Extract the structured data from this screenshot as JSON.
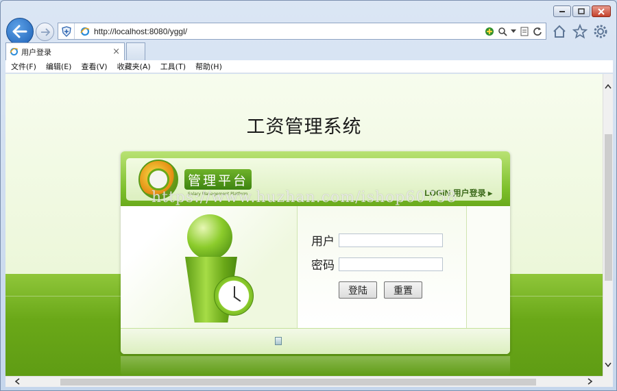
{
  "browser": {
    "url": "http://localhost:8080/yggl/",
    "tab_title": "用户登录",
    "tab_close": "×",
    "menu": [
      "文件(F)",
      "编辑(E)",
      "查看(V)",
      "收藏夹(A)",
      "工具(T)",
      "帮助(H)"
    ]
  },
  "page": {
    "title": "工资管理系统",
    "panel": {
      "badge": "管理平台",
      "badge_sub": "Salary Management Platform",
      "login_link": "LOGIN 用户登录 ▸",
      "user_label": "用户",
      "user_value": "",
      "password_label": "密码",
      "password_value": "",
      "login_button": "登陆",
      "reset_button": "重置"
    },
    "watermark": "https://www.huzhan.com/ishop60758"
  },
  "colors": {
    "accent_green": "#6aa818",
    "ie_blue": "#1c5fb5"
  }
}
